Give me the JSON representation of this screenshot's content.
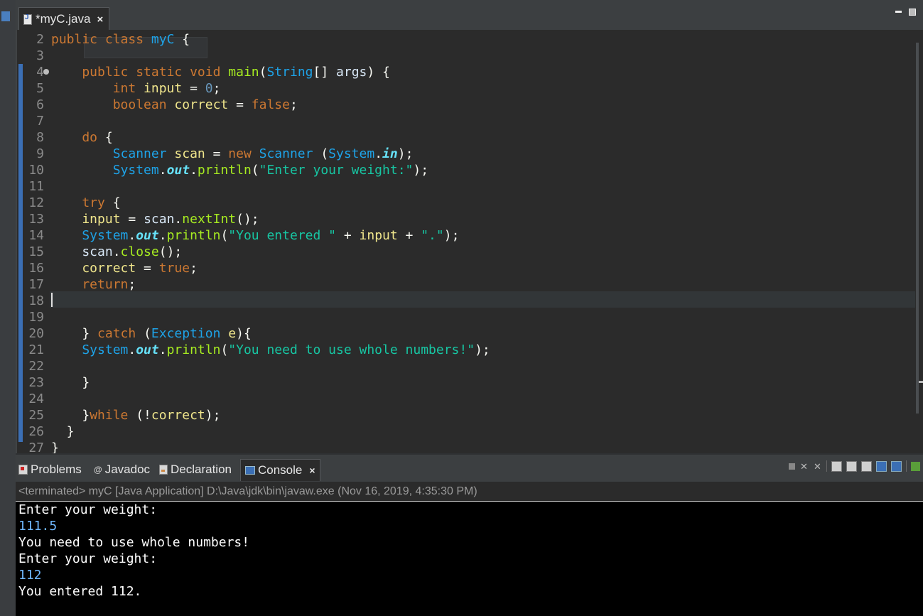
{
  "editor": {
    "tab_title": "*myC.java",
    "tab_close": "×",
    "lines": [
      {
        "n": "2",
        "tokens": [
          [
            "kw",
            "public "
          ],
          [
            "kw",
            "class "
          ],
          [
            "cls",
            "myC"
          ],
          [
            "punc",
            " {"
          ]
        ]
      },
      {
        "n": "3",
        "tokens": []
      },
      {
        "n": "4",
        "fold": true,
        "tokens": [
          [
            "kw",
            "    public "
          ],
          [
            "kw",
            "static "
          ],
          [
            "kw",
            "void "
          ],
          [
            "meth",
            "main"
          ],
          [
            "punc",
            "("
          ],
          [
            "cls",
            "String"
          ],
          [
            "punc",
            "[] "
          ],
          [
            "ident2",
            "args"
          ],
          [
            "punc",
            ") {"
          ]
        ]
      },
      {
        "n": "5",
        "tokens": [
          [
            "kw",
            "        int "
          ],
          [
            "ident",
            "input"
          ],
          [
            "punc",
            " = "
          ],
          [
            "num",
            "0"
          ],
          [
            "punc",
            ";"
          ]
        ]
      },
      {
        "n": "6",
        "tokens": [
          [
            "kw",
            "        boolean "
          ],
          [
            "ident",
            "correct"
          ],
          [
            "punc",
            " = "
          ],
          [
            "kw",
            "false"
          ],
          [
            "punc",
            ";"
          ]
        ]
      },
      {
        "n": "7",
        "tokens": []
      },
      {
        "n": "8",
        "tokens": [
          [
            "kw",
            "    do "
          ],
          [
            "punc",
            "{"
          ]
        ]
      },
      {
        "n": "9",
        "tokens": [
          [
            "cls",
            "        Scanner "
          ],
          [
            "ident",
            "scan"
          ],
          [
            "punc",
            " = "
          ],
          [
            "kw",
            "new "
          ],
          [
            "cls",
            "Scanner "
          ],
          [
            "punc",
            "("
          ],
          [
            "cls",
            "System"
          ],
          [
            "punc",
            "."
          ],
          [
            "field",
            "in"
          ],
          [
            "punc",
            ");"
          ]
        ]
      },
      {
        "n": "10",
        "tokens": [
          [
            "cls",
            "        System"
          ],
          [
            "punc",
            "."
          ],
          [
            "field",
            "out"
          ],
          [
            "punc",
            "."
          ],
          [
            "meth",
            "println"
          ],
          [
            "punc",
            "("
          ],
          [
            "str",
            "\"Enter your weight:\""
          ],
          [
            "punc",
            ");"
          ]
        ]
      },
      {
        "n": "11",
        "tokens": []
      },
      {
        "n": "12",
        "tokens": [
          [
            "kw",
            "    try "
          ],
          [
            "punc",
            "{"
          ]
        ]
      },
      {
        "n": "13",
        "tokens": [
          [
            "ident",
            "    input"
          ],
          [
            "punc",
            " = "
          ],
          [
            "ident2",
            "scan"
          ],
          [
            "punc",
            "."
          ],
          [
            "meth",
            "nextInt"
          ],
          [
            "punc",
            "();"
          ]
        ]
      },
      {
        "n": "14",
        "tokens": [
          [
            "cls",
            "    System"
          ],
          [
            "punc",
            "."
          ],
          [
            "field",
            "out"
          ],
          [
            "punc",
            "."
          ],
          [
            "meth",
            "println"
          ],
          [
            "punc",
            "("
          ],
          [
            "str",
            "\"You entered \""
          ],
          [
            "punc",
            " + "
          ],
          [
            "ident",
            "input"
          ],
          [
            "punc",
            " + "
          ],
          [
            "str",
            "\".\""
          ],
          [
            "punc",
            ");"
          ]
        ]
      },
      {
        "n": "15",
        "tokens": [
          [
            "ident2",
            "    scan"
          ],
          [
            "punc",
            "."
          ],
          [
            "meth",
            "close"
          ],
          [
            "punc",
            "();"
          ]
        ]
      },
      {
        "n": "16",
        "tokens": [
          [
            "ident",
            "    correct"
          ],
          [
            "punc",
            " = "
          ],
          [
            "kw",
            "true"
          ],
          [
            "punc",
            ";"
          ]
        ]
      },
      {
        "n": "17",
        "tokens": [
          [
            "kw",
            "    return"
          ],
          [
            "punc",
            ";"
          ]
        ]
      },
      {
        "n": "18",
        "tokens": []
      },
      {
        "n": "19",
        "tokens": []
      },
      {
        "n": "20",
        "tokens": [
          [
            "punc",
            "    } "
          ],
          [
            "kw",
            "catch "
          ],
          [
            "punc",
            "("
          ],
          [
            "cls",
            "Exception "
          ],
          [
            "ident",
            "e"
          ],
          [
            "punc",
            "){"
          ]
        ]
      },
      {
        "n": "21",
        "tokens": [
          [
            "cls",
            "    System"
          ],
          [
            "punc",
            "."
          ],
          [
            "field",
            "out"
          ],
          [
            "punc",
            "."
          ],
          [
            "meth",
            "println"
          ],
          [
            "punc",
            "("
          ],
          [
            "str",
            "\"You need to use whole numbers!\""
          ],
          [
            "punc",
            ");"
          ]
        ]
      },
      {
        "n": "22",
        "tokens": []
      },
      {
        "n": "23",
        "tokens": [
          [
            "punc",
            "    }"
          ]
        ]
      },
      {
        "n": "24",
        "tokens": []
      },
      {
        "n": "25",
        "tokens": [
          [
            "punc",
            "    }"
          ],
          [
            "kw",
            "while "
          ],
          [
            "punc",
            "(!"
          ],
          [
            "ident",
            "correct"
          ],
          [
            "punc",
            ");"
          ]
        ]
      },
      {
        "n": "26",
        "tokens": [
          [
            "punc",
            "  }"
          ]
        ]
      },
      {
        "n": "27",
        "tokens": [
          [
            "punc",
            "}"
          ]
        ]
      }
    ]
  },
  "panel": {
    "tabs": [
      {
        "label": "Problems",
        "icon": "problems-icon"
      },
      {
        "label": "Javadoc",
        "icon": "javadoc-icon",
        "glyph": "@"
      },
      {
        "label": "Declaration",
        "icon": "declaration-icon"
      },
      {
        "label": "Console",
        "icon": "console-icon",
        "active": true
      }
    ],
    "close": "×",
    "console_header": "<terminated> myC [Java Application] D:\\Java\\jdk\\bin\\javaw.exe (Nov 16, 2019, 4:35:30 PM)",
    "console_lines": [
      {
        "text": "Enter your weight:",
        "input": false
      },
      {
        "text": "111.5",
        "input": true
      },
      {
        "text": "You need to use whole numbers!",
        "input": false
      },
      {
        "text": "Enter your weight:",
        "input": false
      },
      {
        "text": "112",
        "input": true
      },
      {
        "text": "You entered 112.",
        "input": false
      }
    ]
  },
  "colors": {
    "keyword": "#cc7832",
    "class": "#1ea3e8",
    "identifier": "#f0e68c",
    "string": "#17c6a3",
    "number": "#6897bb",
    "field": "#66e1f8",
    "method": "#a7ec21",
    "console_input": "#6fb7ff"
  }
}
